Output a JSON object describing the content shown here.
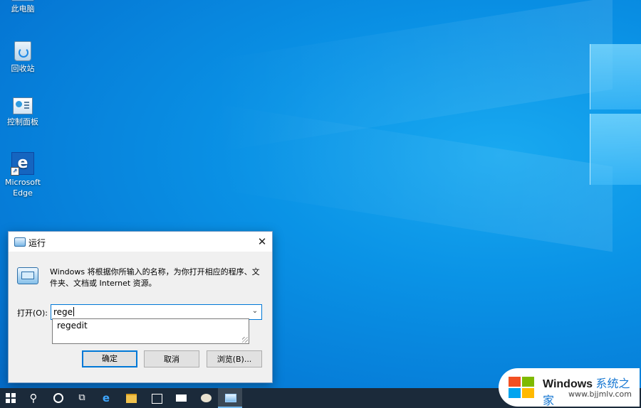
{
  "desktop": {
    "icons": [
      {
        "label": "此电脑"
      },
      {
        "label": "回收站"
      },
      {
        "label": "控制面板"
      },
      {
        "label": "Microsoft Edge"
      }
    ]
  },
  "run_dialog": {
    "title": "运行",
    "close_glyph": "✕",
    "description": "Windows 将根据你所输入的名称，为你打开相应的程序、文件夹、文档或 Internet 资源。",
    "open_label": "打开(O):",
    "input_value": "rege",
    "dropdown_glyph": "⌄",
    "suggestion": "regedit",
    "ok_label": "确定",
    "cancel_label": "取消",
    "browse_label": "浏览(B)..."
  },
  "taskbar": {
    "search_glyph": "⚲",
    "taskview_glyph": "⧉",
    "edge_glyph": "e"
  },
  "watermark": {
    "title": "Windows",
    "title_cn": "系统之家",
    "url": "www.bjjmlv.com"
  }
}
